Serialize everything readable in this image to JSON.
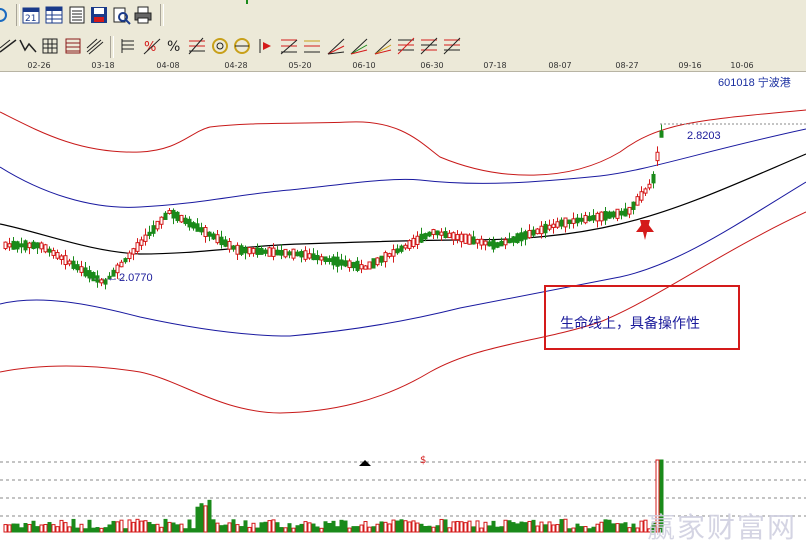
{
  "stock": {
    "code": "601018",
    "name": "宁波港",
    "title": "601018  宁波港"
  },
  "toolbar": {
    "row1_icons": [
      "calendar-21-icon",
      "spreadsheet-icon",
      "save-disk-icon",
      "print-preview-icon",
      "printer-icon"
    ],
    "row2_icons": [
      "trendline-icon",
      "polyline-icon",
      "grid-icon",
      "channel-icon",
      "parallel-lines-icon",
      "bar-chart-icon",
      "fib-percent-icon",
      "percent-icon",
      "gann-icon",
      "circle-icon",
      "pitchfork-icon",
      "fib-retracement-icon",
      "fib-fan-icon",
      "fib-time-icon",
      "fib-arc-icon",
      "speed-line-icon",
      "cycle-icon",
      "wave-icon"
    ]
  },
  "date_axis": {
    "labels": [
      "02-26",
      "03-18",
      "04-08",
      "04-28",
      "05-20",
      "06-10",
      "06-30",
      "07-18",
      "08-07",
      "08-27",
      "09-16",
      "10-06"
    ]
  },
  "annotation": {
    "text": "生命线上，具备操作性",
    "border_color": "#d41a1a"
  },
  "price_labels": {
    "high": "2.8203",
    "low": "2.0770",
    "low_prefix": "←"
  },
  "watermark": "赢家财富网",
  "markers": {
    "dollar": "$"
  },
  "chart_data": {
    "type": "candlestick",
    "title": "601018 宁波港",
    "series_names": [
      "upper-outer-band",
      "upper-band",
      "middle-line",
      "lower-band",
      "lower-outer-band"
    ],
    "price_high": 2.8203,
    "price_low": 2.077,
    "candles_approx": [
      {
        "date": "02-26",
        "close": 2.3
      },
      {
        "date": "03-18",
        "close": 2.13
      },
      {
        "date": "04-08",
        "close": 2.45
      },
      {
        "date": "04-28",
        "close": 2.28
      },
      {
        "date": "05-20",
        "close": 2.26
      },
      {
        "date": "06-10",
        "close": 2.2
      },
      {
        "date": "06-30",
        "close": 2.36
      },
      {
        "date": "07-18",
        "close": 2.3
      },
      {
        "date": "08-07",
        "close": 2.4
      },
      {
        "date": "08-27",
        "close": 2.45
      },
      {
        "date": "09-16",
        "close": 2.8
      }
    ],
    "colors": {
      "up": "#d41a1a",
      "down": "#1a8a1a",
      "middle": "#000000",
      "band": "#1a1aa0",
      "outer": "#c81a1a"
    }
  }
}
